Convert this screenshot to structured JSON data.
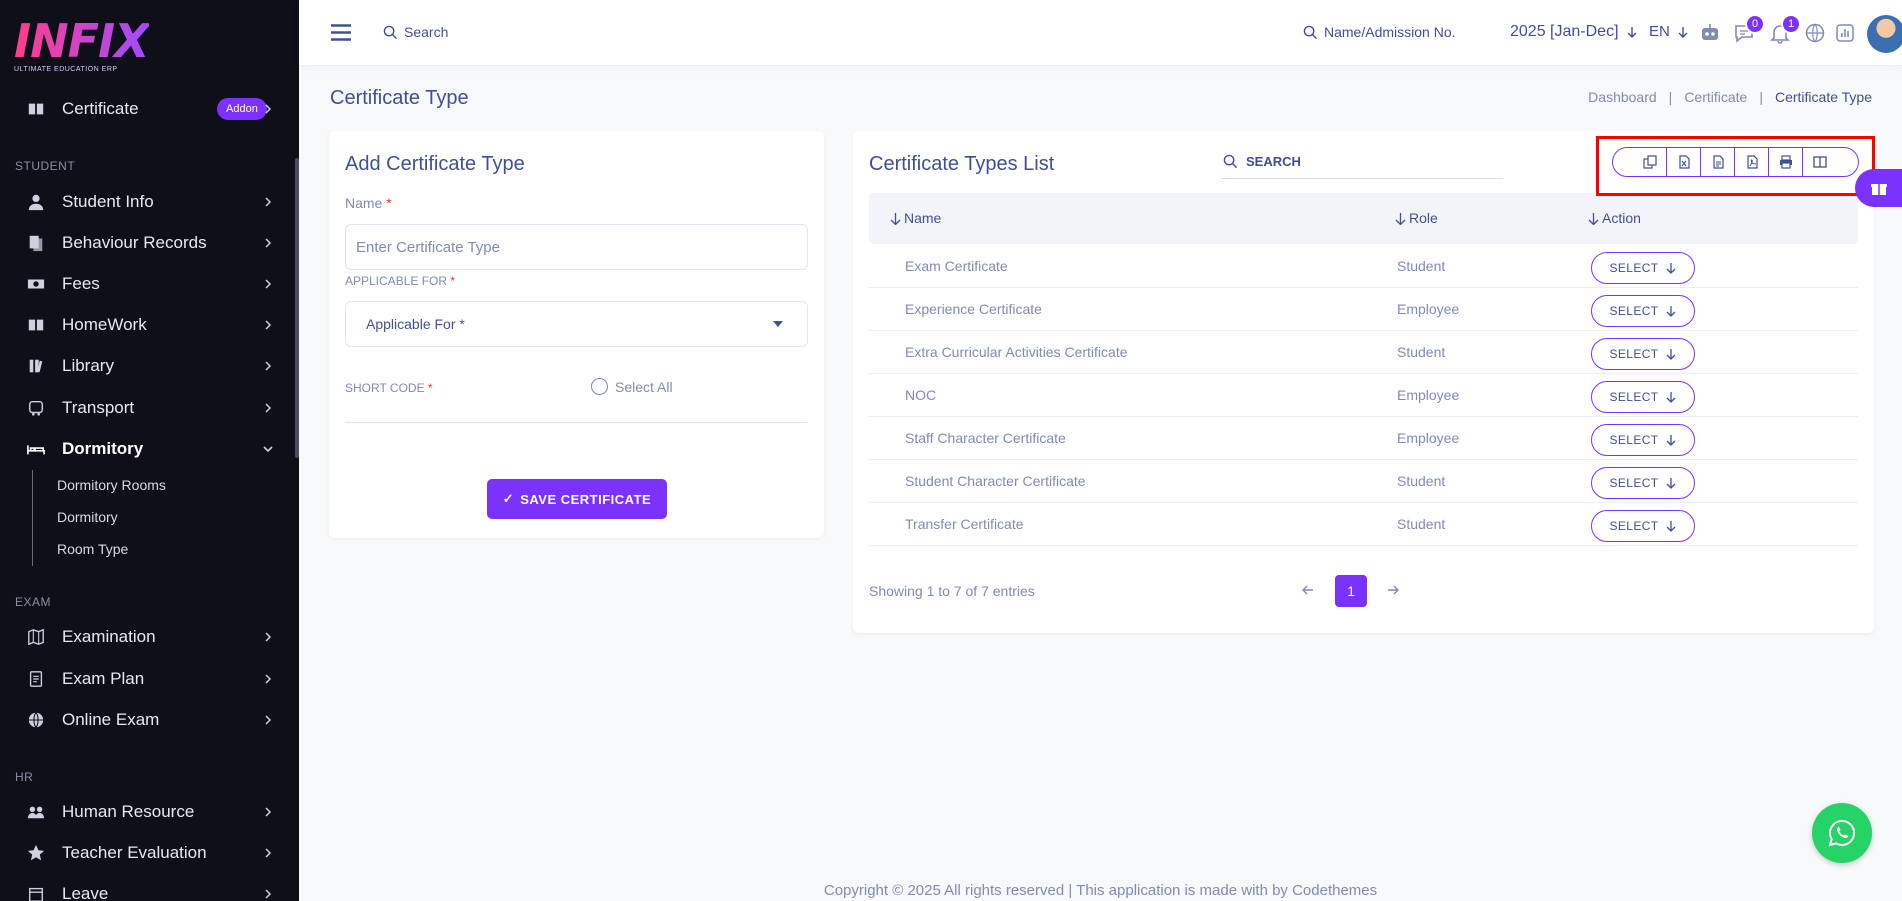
{
  "brand": {
    "logo_text": "INFIX",
    "tagline": "ULTIMATE EDUCATION ERP"
  },
  "sidebar": {
    "top_item": {
      "label": "Certificate",
      "badge": "Addon"
    },
    "sections": {
      "student": "STUDENT",
      "exam": "EXAM",
      "hr": "HR"
    },
    "student_items": [
      {
        "label": "Student Info",
        "icon": "user-icon"
      },
      {
        "label": "Behaviour Records",
        "icon": "records-icon"
      },
      {
        "label": "Fees",
        "icon": "money-icon"
      },
      {
        "label": "HomeWork",
        "icon": "book-icon"
      },
      {
        "label": "Library",
        "icon": "library-icon"
      },
      {
        "label": "Transport",
        "icon": "bus-icon"
      },
      {
        "label": "Dormitory",
        "icon": "bed-icon"
      }
    ],
    "dormitory_sub": [
      "Dormitory Rooms",
      "Dormitory",
      "Room Type"
    ],
    "exam_items": [
      {
        "label": "Examination",
        "icon": "map-icon"
      },
      {
        "label": "Exam Plan",
        "icon": "plan-icon"
      },
      {
        "label": "Online Exam",
        "icon": "globe-icon"
      }
    ],
    "hr_items": [
      {
        "label": "Human Resource",
        "icon": "people-icon"
      },
      {
        "label": "Teacher Evaluation",
        "icon": "star-icon"
      },
      {
        "label": "Leave",
        "icon": "leave-icon"
      }
    ]
  },
  "topbar": {
    "search_label": "Search",
    "admission_search": "Name/Admission No.",
    "year": "2025 [Jan-Dec]",
    "lang": "EN",
    "chat_count": "0",
    "notif_count": "1"
  },
  "page": {
    "title": "Certificate Type",
    "breadcrumb": [
      "Dashboard",
      "|",
      "Certificate",
      "|",
      "Certificate Type"
    ]
  },
  "form": {
    "title": "Add Certificate Type",
    "name_label": "Name",
    "name_placeholder": "Enter Certificate Type",
    "applicable_label": "APPLICABLE FOR",
    "applicable_value": "Applicable For *",
    "short_code_label": "SHORT CODE",
    "select_all": "Select All",
    "required_mark": "*",
    "save_label": "SAVE CERTIFICATE",
    "save_check": "✓"
  },
  "list": {
    "title": "Certificate Types List",
    "search_label": "SEARCH",
    "columns": [
      "Name",
      "Role",
      "Action"
    ],
    "rows": [
      {
        "name": "Exam Certificate",
        "role": "Student",
        "action": "SELECT"
      },
      {
        "name": "Experience Certificate",
        "role": "Employee",
        "action": "SELECT"
      },
      {
        "name": "Extra Curricular Activities Certificate",
        "role": "Student",
        "action": "SELECT"
      },
      {
        "name": "NOC",
        "role": "Employee",
        "action": "SELECT"
      },
      {
        "name": "Staff Character Certificate",
        "role": "Employee",
        "action": "SELECT"
      },
      {
        "name": "Student Character Certificate",
        "role": "Student",
        "action": "SELECT"
      },
      {
        "name": "Transfer Certificate",
        "role": "Student",
        "action": "SELECT"
      }
    ],
    "showing": "Showing 1 to 7 of 7 entries",
    "current_page": "1",
    "export_tools": [
      "copy-icon",
      "excel-icon",
      "csv-icon",
      "pdf-icon",
      "print-icon",
      "columns-icon"
    ]
  },
  "footer": {
    "text": "Copyright © 2025 All rights reserved | This application is made with by Codethemes"
  },
  "colors": {
    "accent": "#7c32ff",
    "text": "#415094",
    "muted": "#828bb2",
    "sidebar": "#0f0f1a",
    "highlight": "#ff0000",
    "whatsapp": "#25d366"
  }
}
